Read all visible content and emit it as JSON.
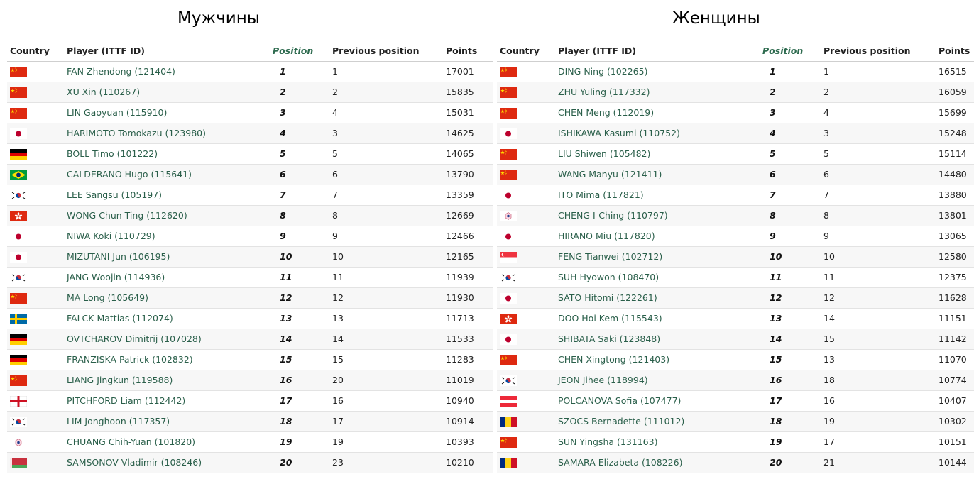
{
  "men": {
    "title": "Мужчины",
    "headers": {
      "country": "Country",
      "player": "Player (ITTF ID)",
      "position": "Position",
      "previous": "Previous position",
      "points": "Points"
    },
    "rows": [
      {
        "flag": "cn",
        "player": "FAN Zhendong (121404)",
        "position": "1",
        "previous": "1",
        "points": "17001"
      },
      {
        "flag": "cn",
        "player": "XU Xin (110267)",
        "position": "2",
        "previous": "2",
        "points": "15835"
      },
      {
        "flag": "cn",
        "player": "LIN Gaoyuan (115910)",
        "position": "3",
        "previous": "4",
        "points": "15031"
      },
      {
        "flag": "jp",
        "player": "HARIMOTO Tomokazu (123980)",
        "position": "4",
        "previous": "3",
        "points": "14625"
      },
      {
        "flag": "de",
        "player": "BOLL Timo (101222)",
        "position": "5",
        "previous": "5",
        "points": "14065"
      },
      {
        "flag": "br",
        "player": "CALDERANO Hugo (115641)",
        "position": "6",
        "previous": "6",
        "points": "13790"
      },
      {
        "flag": "kr",
        "player": "LEE Sangsu (105197)",
        "position": "7",
        "previous": "7",
        "points": "13359"
      },
      {
        "flag": "hk",
        "player": "WONG Chun Ting (112620)",
        "position": "8",
        "previous": "8",
        "points": "12669"
      },
      {
        "flag": "jp",
        "player": "NIWA Koki (110729)",
        "position": "9",
        "previous": "9",
        "points": "12466"
      },
      {
        "flag": "jp",
        "player": "MIZUTANI Jun (106195)",
        "position": "10",
        "previous": "10",
        "points": "12165"
      },
      {
        "flag": "kr",
        "player": "JANG Woojin (114936)",
        "position": "11",
        "previous": "11",
        "points": "11939"
      },
      {
        "flag": "cn",
        "player": "MA Long (105649)",
        "position": "12",
        "previous": "12",
        "points": "11930"
      },
      {
        "flag": "se",
        "player": "FALCK Mattias (112074)",
        "position": "13",
        "previous": "13",
        "points": "11713"
      },
      {
        "flag": "de",
        "player": "OVTCHAROV Dimitrij (107028)",
        "position": "14",
        "previous": "14",
        "points": "11533"
      },
      {
        "flag": "de",
        "player": "FRANZISKA Patrick (102832)",
        "position": "15",
        "previous": "15",
        "points": "11283"
      },
      {
        "flag": "cn",
        "player": "LIANG Jingkun (119588)",
        "position": "16",
        "previous": "20",
        "points": "11019"
      },
      {
        "flag": "en",
        "player": "PITCHFORD Liam (112442)",
        "position": "17",
        "previous": "16",
        "points": "10940"
      },
      {
        "flag": "kr",
        "player": "LIM Jonghoon (117357)",
        "position": "18",
        "previous": "17",
        "points": "10914"
      },
      {
        "flag": "tpe",
        "player": "CHUANG Chih-Yuan (101820)",
        "position": "19",
        "previous": "19",
        "points": "10393"
      },
      {
        "flag": "by",
        "player": "SAMSONOV Vladimir (108246)",
        "position": "20",
        "previous": "23",
        "points": "10210"
      }
    ]
  },
  "women": {
    "title": "Женщины",
    "headers": {
      "country": "Country",
      "player": "Player (ITTF ID)",
      "position": "Position",
      "previous": "Previous position",
      "points": "Points"
    },
    "rows": [
      {
        "flag": "cn",
        "player": "DING Ning (102265)",
        "position": "1",
        "previous": "1",
        "points": "16515"
      },
      {
        "flag": "cn",
        "player": "ZHU Yuling (117332)",
        "position": "2",
        "previous": "2",
        "points": "16059"
      },
      {
        "flag": "cn",
        "player": "CHEN Meng (112019)",
        "position": "3",
        "previous": "4",
        "points": "15699"
      },
      {
        "flag": "jp",
        "player": "ISHIKAWA Kasumi (110752)",
        "position": "4",
        "previous": "3",
        "points": "15248"
      },
      {
        "flag": "cn",
        "player": "LIU Shiwen (105482)",
        "position": "5",
        "previous": "5",
        "points": "15114"
      },
      {
        "flag": "cn",
        "player": "WANG Manyu (121411)",
        "position": "6",
        "previous": "6",
        "points": "14480"
      },
      {
        "flag": "jp",
        "player": "ITO Mima (117821)",
        "position": "7",
        "previous": "7",
        "points": "13880"
      },
      {
        "flag": "tpe",
        "player": "CHENG I-Ching (110797)",
        "position": "8",
        "previous": "8",
        "points": "13801"
      },
      {
        "flag": "jp",
        "player": "HIRANO Miu (117820)",
        "position": "9",
        "previous": "9",
        "points": "13065"
      },
      {
        "flag": "sg",
        "player": "FENG Tianwei (102712)",
        "position": "10",
        "previous": "10",
        "points": "12580"
      },
      {
        "flag": "kr",
        "player": "SUH Hyowon (108470)",
        "position": "11",
        "previous": "11",
        "points": "12375"
      },
      {
        "flag": "jp",
        "player": "SATO Hitomi (122261)",
        "position": "12",
        "previous": "12",
        "points": "11628"
      },
      {
        "flag": "hk",
        "player": "DOO Hoi Kem (115543)",
        "position": "13",
        "previous": "14",
        "points": "11151"
      },
      {
        "flag": "jp",
        "player": "SHIBATA Saki (123848)",
        "position": "14",
        "previous": "15",
        "points": "11142"
      },
      {
        "flag": "cn",
        "player": "CHEN Xingtong (121403)",
        "position": "15",
        "previous": "13",
        "points": "11070"
      },
      {
        "flag": "kr",
        "player": "JEON Jihee (118994)",
        "position": "16",
        "previous": "18",
        "points": "10774"
      },
      {
        "flag": "at",
        "player": "POLCANOVA Sofia (107477)",
        "position": "17",
        "previous": "16",
        "points": "10407"
      },
      {
        "flag": "ro",
        "player": "SZOCS Bernadette (111012)",
        "position": "18",
        "previous": "19",
        "points": "10302"
      },
      {
        "flag": "cn",
        "player": "SUN Yingsha (131163)",
        "position": "19",
        "previous": "17",
        "points": "10151"
      },
      {
        "flag": "ro",
        "player": "SAMARA Elizabeta (108226)",
        "position": "20",
        "previous": "21",
        "points": "10144"
      }
    ]
  },
  "colors": {
    "player_link": "#2a5f4a",
    "position_header": "#2e6b4f"
  }
}
